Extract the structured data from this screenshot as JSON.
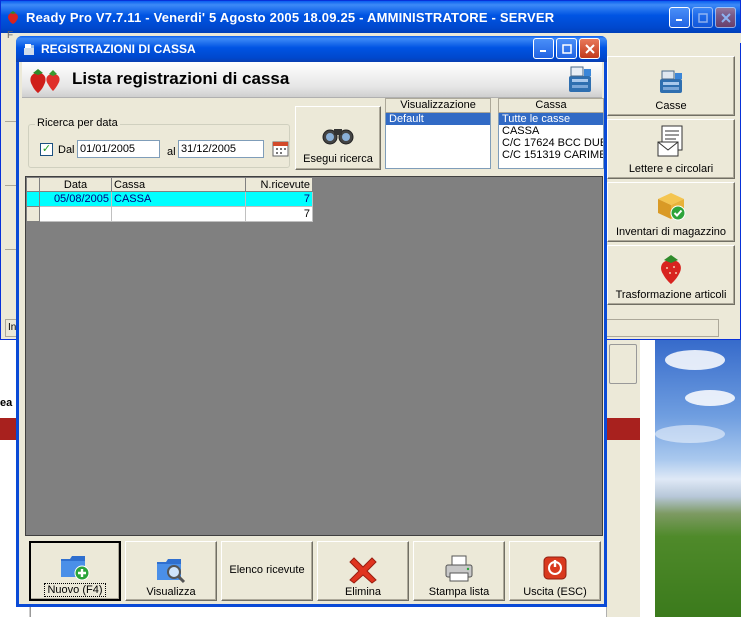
{
  "app": {
    "title": "Ready Pro V7.7.11 - Venerdi' 5 Agosto 2005  18.09.25 - AMMINISTRATORE - SERVER",
    "menu_hint": "F",
    "status_hint": "In",
    "background_fragment": "ea"
  },
  "side_buttons": [
    {
      "label": "Casse",
      "icon": "cash-register-icon"
    },
    {
      "label": "Lettere e circolari",
      "icon": "letter-icon"
    },
    {
      "label": "Inventari di magazzino",
      "icon": "inventory-box-icon"
    },
    {
      "label": "Trasformazione articoli",
      "icon": "strawberry-icon"
    }
  ],
  "dialog": {
    "title": "REGISTRAZIONI DI CASSA",
    "header": "Lista registrazioni di cassa",
    "search": {
      "group_label": "Ricerca per data",
      "checked": true,
      "check_mark": "✓",
      "from_label": "Dal",
      "from_value": "01/01/2005",
      "to_label": "al",
      "to_value": "31/12/2005",
      "button_label": "Esegui ricerca"
    },
    "views": {
      "header": "Visualizzazione",
      "items": [
        "Default"
      ],
      "selected": 0
    },
    "casse": {
      "header": "Cassa",
      "items": [
        "Tutte le casse",
        "CASSA",
        "C/C 17624 BCC DUE",
        "C/C 151319 CARIME"
      ],
      "selected": 0
    },
    "grid": {
      "columns": [
        "Data",
        "Cassa",
        "N.ricevute"
      ],
      "rows": [
        {
          "data": "05/08/2005",
          "cassa": "CASSA",
          "ricevute": "7"
        }
      ],
      "total": {
        "data": "",
        "cassa": "",
        "ricevute": "7"
      }
    },
    "toolbar": {
      "new_label": "Nuovo (F4)",
      "view_label": "Visualizza",
      "receipts_label": "Elenco ricevute",
      "delete_label": "Elimina",
      "print_label": "Stampa lista",
      "exit_label": "Uscita (ESC)"
    }
  },
  "colors": {
    "titlebar": "#0054e3",
    "selected_row": "#00ffff",
    "selection": "#316ac5",
    "grid_background": "#808080"
  }
}
